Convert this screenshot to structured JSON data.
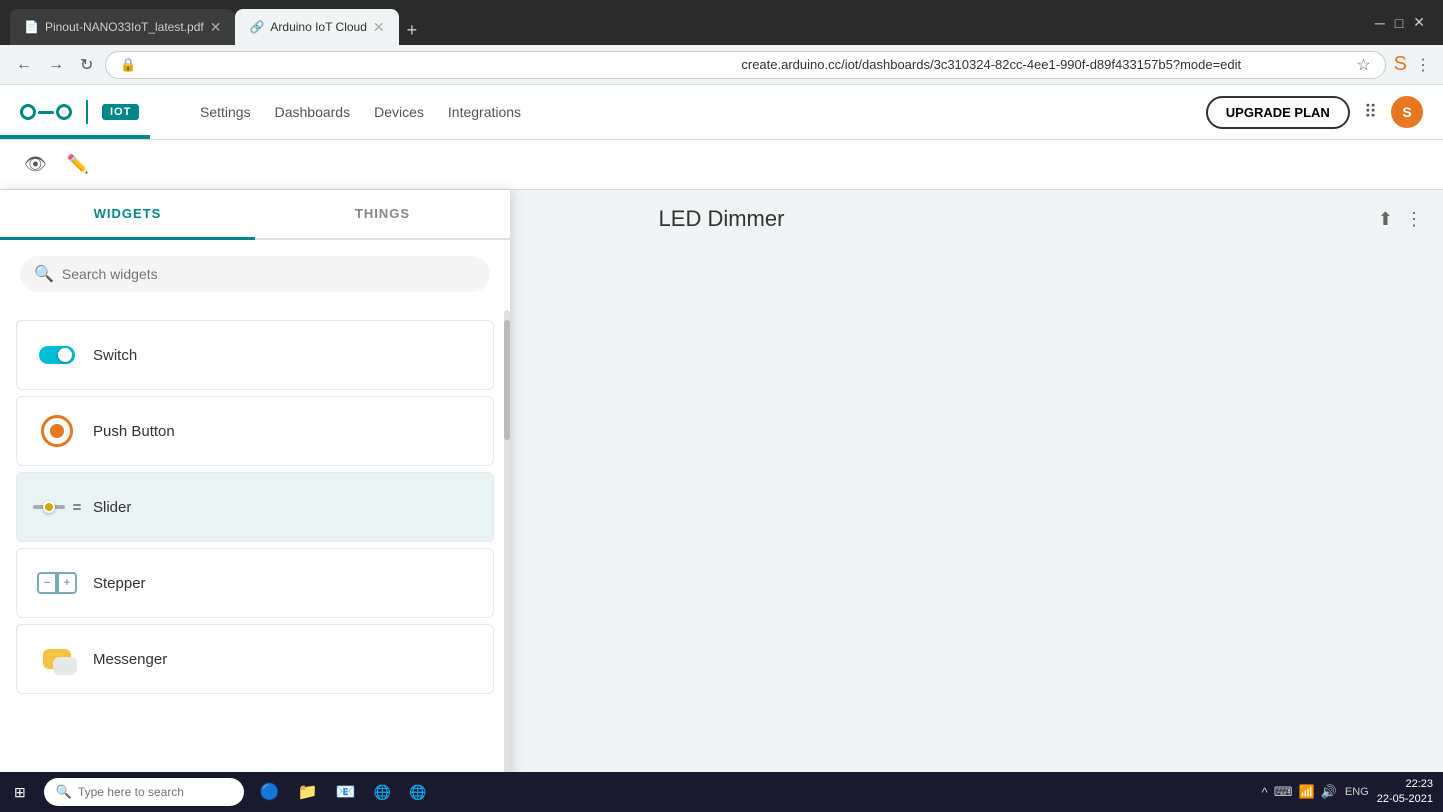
{
  "browser": {
    "tabs": [
      {
        "id": "tab1",
        "label": "Pinout-NANO33IoT_latest.pdf",
        "active": false,
        "favicon": "📄"
      },
      {
        "id": "tab2",
        "label": "Arduino IoT Cloud",
        "active": true,
        "favicon": "🔗"
      }
    ],
    "address": "create.arduino.cc/iot/dashboards/3c310324-82cc-4ee1-990f-d89f433157b5?mode=edit",
    "new_tab_label": "+"
  },
  "header": {
    "logo_text": "IOT",
    "nav_items": [
      "Settings",
      "Dashboards",
      "Devices",
      "Integrations"
    ],
    "upgrade_btn": "UPGRADE PLAN"
  },
  "sub_header": {
    "view_icon": "👁",
    "edit_icon": "✏️"
  },
  "dashboard": {
    "title": "LED Dimmer",
    "share_icon": "share",
    "more_icon": "more"
  },
  "widget_panel": {
    "tab_widgets": "WIDGETS",
    "tab_things": "THINGS",
    "search_placeholder": "Search widgets",
    "widgets": [
      {
        "id": "switch",
        "label": "Switch",
        "highlighted": false
      },
      {
        "id": "push_button",
        "label": "Push Button",
        "highlighted": false
      },
      {
        "id": "slider",
        "label": "Slider",
        "highlighted": true
      },
      {
        "id": "stepper",
        "label": "Stepper",
        "highlighted": false
      },
      {
        "id": "messenger",
        "label": "Messenger",
        "highlighted": false
      }
    ]
  },
  "taskbar": {
    "start_icon": "⊞",
    "search_placeholder": "Type here to search",
    "icons": [
      "🗂",
      "📁",
      "📧",
      "🌐",
      "🌐"
    ],
    "time": "22:23",
    "date": "22-05-2021",
    "lang": "ENG"
  }
}
